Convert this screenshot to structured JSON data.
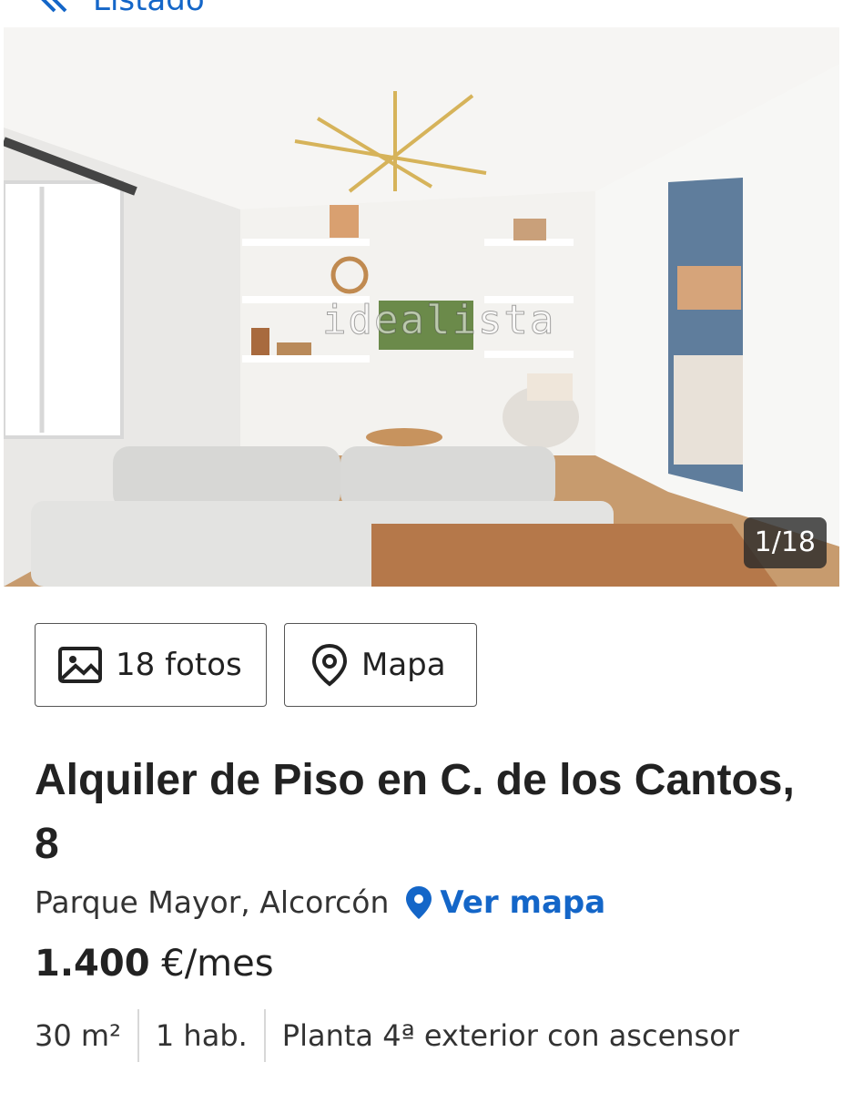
{
  "nav": {
    "back_label": "Listado"
  },
  "gallery": {
    "counter": "1/18",
    "watermark": "idealista"
  },
  "actions": {
    "photos_label": "18 fotos",
    "map_label": "Mapa"
  },
  "listing": {
    "title": "Alquiler de Piso en C. de los Cantos, 8",
    "location": "Parque Mayor, Alcorcón",
    "see_map_label": "Ver mapa",
    "price_amount": "1.400",
    "price_unit": "€/mes",
    "features": [
      "30 m²",
      "1 hab.",
      "Planta 4ª exterior con ascensor"
    ]
  },
  "colors": {
    "accent": "#1466c8",
    "text": "#222222",
    "border": "#555555"
  },
  "icons": [
    "chevron-double-left-icon",
    "image-icon",
    "map-pin-icon"
  ]
}
